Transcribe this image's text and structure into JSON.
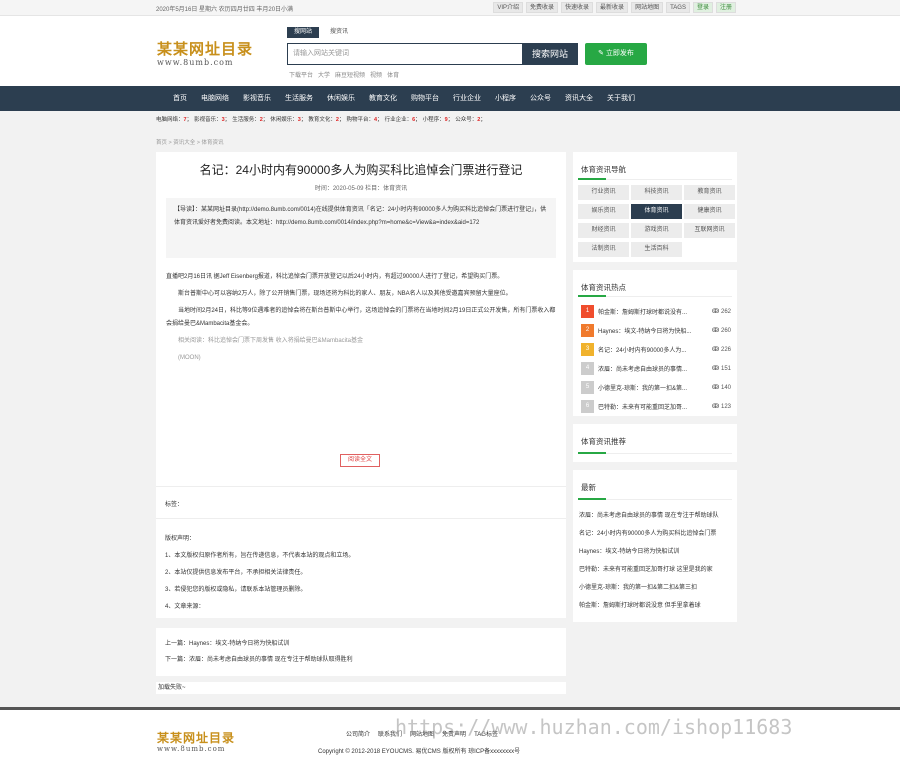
{
  "topbar": {
    "date": "2020年5月16日 星期六 农历四月廿四 丰月20日小满",
    "links": [
      "VIP介绍",
      "免费收录",
      "快速收录",
      "最新收录",
      "网站地图",
      "TAGS"
    ],
    "login": "登录",
    "register": "注册"
  },
  "logo": {
    "main": "某某网址目录",
    "sub": "www.8umb.com"
  },
  "search": {
    "tabs": [
      "搜网站",
      "搜资讯"
    ],
    "placeholder": "请输入网站关键词",
    "button": "搜索网站",
    "post_button": "✎ 立即发布",
    "hotwords": [
      "下载平台",
      "大学",
      "麻豆短视频",
      "视频",
      "体育"
    ]
  },
  "nav": [
    "首页",
    "电脑网络",
    "影视音乐",
    "生活服务",
    "休闲娱乐",
    "教育文化",
    "购物平台",
    "行业企业",
    "小程序",
    "公众号",
    "资讯大全",
    "关于我们"
  ],
  "catbar": [
    {
      "name": "电脑网络：",
      "count": "7"
    },
    {
      "name": "影视音乐：",
      "count": "3"
    },
    {
      "name": "生活服务：",
      "count": "2"
    },
    {
      "name": "休闲娱乐：",
      "count": "3"
    },
    {
      "name": "教育文化：",
      "count": "2"
    },
    {
      "name": "购物平台：",
      "count": "4"
    },
    {
      "name": "行业企业：",
      "count": "6"
    },
    {
      "name": "小程序：",
      "count": "9"
    },
    {
      "name": "公众号：",
      "count": "2"
    }
  ],
  "breadcrumb": "首页 > 资讯大全 > 体育资讯",
  "article": {
    "title": "名记：24小时内有90000多人为购买科比追悼会门票进行登记",
    "meta": "时间：2020-05-09 栏目：体育资讯",
    "lead": "【导读】：某某网址目录(http://demo.8umb.com/0014)在线提供体育资讯「名记：24小时内有90000多人为购买科比追悼会门票进行登记」，供体育资讯爱好者免费阅读。本文地址：http://demo.8umb.com/0014/index.php?m=home&c=View&a=index&aid=172",
    "paragraphs": [
      "直播吧2月16日讯 据Jeff Eisenberg报道，科比追悼会门票开放登记以后24小时内，有超过90000人进行了登记，希望购买门票。",
      "　　斯台普斯中心可以容纳2万人，除了公开销售门票，现场还将为科比的家人、朋友，NBA名人以及其他受邀嘉宾预留大量座位。",
      "　　当地时间2月24日，科比等9位遇难者的追悼会将在斯台普斯中心举行，这场追悼会的门票将在当地时间2月19日正式公开发售，所有门票收入都会捐给曼巴&Mambacita基金会。"
    ],
    "related": "　　相关阅读：科比追悼会门票下周发售 收入将捐给曼巴&Mambacita基金",
    "source": "　　(MOON)",
    "read_more": "阅读全文",
    "tags": "标签：",
    "copyright_title": "版权声明：",
    "copyright_items": [
      "1、本文版权归原作者所有，旨在传递信息，不代表本站的观点和立场。",
      "2、本站仅提供信息发布平台，不承担相关法律责任。",
      "3、若侵犯您的版权或隐私，请联系本站管理员删除。",
      "4、文章来源："
    ],
    "prev": "上一篇：Haynes：埃文-特纳今日将为快船试训",
    "next": "下一篇：浓眉：尚未考虑自由球员的事情 现在专注于帮助球队取得胜利",
    "load_fail": "加载失败~"
  },
  "sidebar": {
    "nav_title": "体育资讯导航",
    "categories": [
      "行业资讯",
      "科技资讯",
      "教育资讯",
      "娱乐资讯",
      "体育资讯",
      "健康资讯",
      "财经资讯",
      "游戏资讯",
      "互联网资讯",
      "法制资讯",
      "生活百科"
    ],
    "hot_title": "体育资讯热点",
    "hot": [
      {
        "rank": "1",
        "title": "帕金斯：詹姆斯打球时都说没有...",
        "count": "ↂ 262"
      },
      {
        "rank": "2",
        "title": "Haynes：埃文-特纳今日将为快船...",
        "count": "ↂ 260"
      },
      {
        "rank": "3",
        "title": "名记：24小时内有90000多人为...",
        "count": "ↂ 226"
      },
      {
        "rank": "4",
        "title": "浓眉：尚未考虑自由球员的事情...",
        "count": "ↂ 151"
      },
      {
        "rank": "5",
        "title": "小德里克-琼斯：我的第一扣&第...",
        "count": "ↂ 140"
      },
      {
        "rank": "6",
        "title": "巴特勒：未来有可能重回芝加哥...",
        "count": "ↂ 123"
      }
    ],
    "rec_title": "体育资讯推荐",
    "latest_title": "最新",
    "latest": [
      "浓眉：尚未考虑自由球员的事情 现在专注于帮助球队",
      "名记：24小时内有90000多人为购买科比追悼会门票",
      "Haynes：埃文-特纳今日将为快船试训",
      "巴特勒：未来有可能重回芝加哥打球 这里是我的家",
      "小德里克-琼斯：我的第一扣&第二扣&第三扣",
      "帕金斯：詹姆斯打球时都说没意 但手里拿着球"
    ]
  },
  "footer": {
    "links": [
      "公司简介",
      "联系我们",
      "网站地图",
      "免责声明",
      "TAG标签"
    ],
    "copyright": "Copyright © 2012-2018 EYOUCMS. 易优CMS 版权所有 琼ICP备xxxxxxxx号"
  },
  "watermark": "https://www.huzhan.com/ishop11683"
}
